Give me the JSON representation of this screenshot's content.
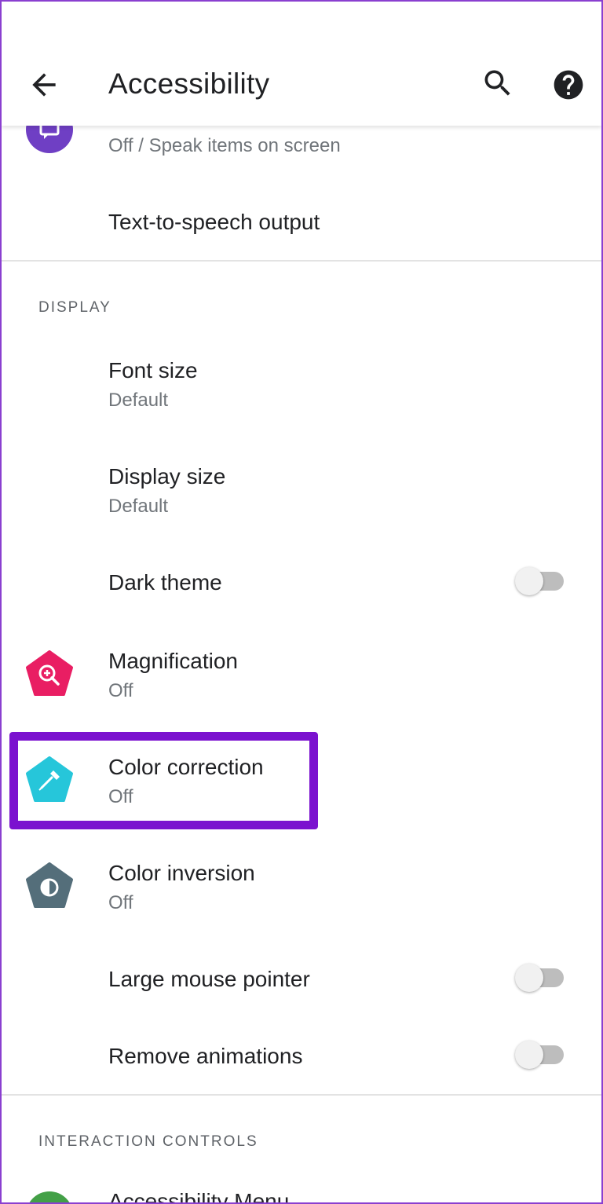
{
  "appbar": {
    "title": "Accessibility",
    "back_icon": "arrow-back-icon",
    "search_icon": "search-icon",
    "help_icon": "help-circle-icon"
  },
  "items": {
    "select_to_speak": {
      "summary": "Off / Speak items on screen",
      "icon": "select-to-speak-icon",
      "icon_color": "#6f3fc4"
    },
    "tts": {
      "title": "Text-to-speech output"
    },
    "display_header": "DISPLAY",
    "font_size": {
      "title": "Font size",
      "summary": "Default"
    },
    "display_size": {
      "title": "Display size",
      "summary": "Default"
    },
    "dark_theme": {
      "title": "Dark theme",
      "toggle": "off"
    },
    "magnification": {
      "title": "Magnification",
      "summary": "Off",
      "icon": "magnification-icon",
      "icon_color": "#e91e63"
    },
    "color_correction": {
      "title": "Color correction",
      "summary": "Off",
      "icon": "color-correction-icon",
      "icon_color": "#26c6da"
    },
    "color_inversion": {
      "title": "Color inversion",
      "summary": "Off",
      "icon": "color-inversion-icon",
      "icon_color": "#546e7a"
    },
    "large_pointer": {
      "title": "Large mouse pointer",
      "toggle": "off"
    },
    "remove_animations": {
      "title": "Remove animations",
      "toggle": "off"
    },
    "interaction_header": "INTERACTION CONTROLS",
    "accessibility_menu": {
      "title": "Accessibility Menu",
      "icon": "accessibility-menu-icon",
      "icon_color": "#43a047"
    }
  },
  "colors": {
    "highlight_border": "#7b12cf",
    "frame_border": "#8a3fd0"
  }
}
